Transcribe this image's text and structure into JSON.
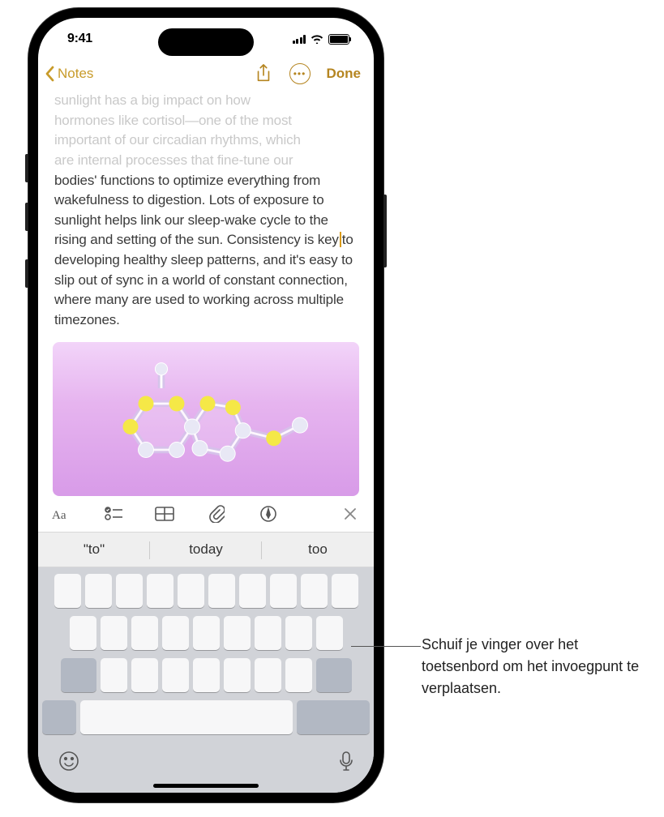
{
  "status": {
    "time": "9:41"
  },
  "nav": {
    "back_label": "Notes",
    "done_label": "Done"
  },
  "note": {
    "faded_top": "sunlight has a big impact on how\nhormones like cortisol—one of the most\nimportant of our circadian rhythms, which\nare internal processes that fine-tune our",
    "body_pre_cursor": "bodies' functions to optimize everything from wakefulness to digestion. Lots of exposure to sunlight helps link our sleep-wake cycle to the rising and setting of the sun. Consistency is key",
    "body_post_cursor": "to developing healthy sleep patterns, and it's easy to slip out of sync in a world of constant connection, where many are used to working across multiple timezones."
  },
  "suggestions": {
    "s1": "\"to\"",
    "s2": "today",
    "s3": "too"
  },
  "callout": {
    "text": "Schuif je vinger over het toetsenbord om het invoegpunt te verplaatsen."
  },
  "colors": {
    "accent": "#b58520"
  }
}
